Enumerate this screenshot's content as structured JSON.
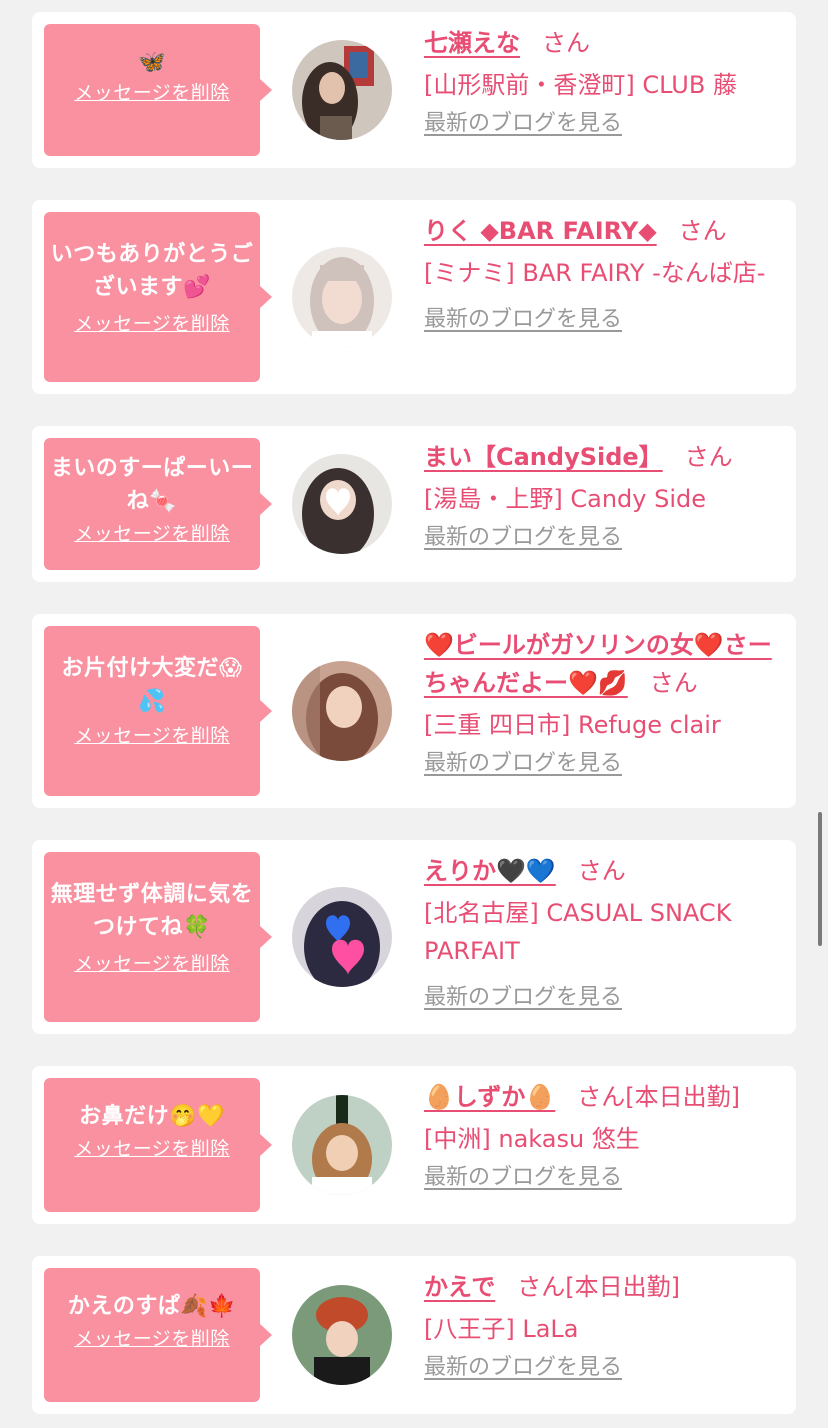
{
  "messages": [
    {
      "message": "🦋",
      "delete_label": "メッセージを削除",
      "name": "七瀬えな",
      "honorific": "さん",
      "shop": "[山形駅前・香澄町] CLUB 藤",
      "blog_label": "最新のブログを見る",
      "avatar_icon": "profile-photo",
      "avatar_color": "#6b5a4e"
    },
    {
      "message": "いつもありがとうございます💕",
      "delete_label": "メッセージを削除",
      "name": "りく ◆BAR FAIRY◆",
      "honorific": "さん",
      "shop": "[ミナミ] BAR FAIRY -なんば店-",
      "blog_label": "最新のブログを見る",
      "avatar_icon": "profile-photo",
      "avatar_color": "#e8dcd8"
    },
    {
      "message": "まいのすーぱーいーね🍬",
      "delete_label": "メッセージを削除",
      "name": "まい【CandySide】",
      "honorific": "さん",
      "shop": "[湯島・上野] Candy Side",
      "blog_label": "最新のブログを見る",
      "avatar_icon": "profile-photo",
      "avatar_color": "#3a3030"
    },
    {
      "message": "お片付け大変だ😱💦",
      "delete_label": "メッセージを削除",
      "name": "❤️ビールがガソリンの女❤️さーちゃんだよー❤️💋",
      "honorific": "さん",
      "shop": "[三重 四日市] Refuge clair",
      "blog_label": "最新のブログを見る",
      "avatar_icon": "profile-photo",
      "avatar_color": "#8a5a4a"
    },
    {
      "message": "無理せず体調に気をつけてね🍀",
      "delete_label": "メッセージを削除",
      "name": "えりか🖤💙",
      "honorific": "さん",
      "shop": "[北名古屋] CASUAL SNACK PARFAIT",
      "blog_label": "最新のブログを見る",
      "avatar_icon": "profile-photo",
      "avatar_color": "#2c2a40"
    },
    {
      "message": "お鼻だけ🤭💛",
      "delete_label": "メッセージを削除",
      "name": "🥚しずか🥚",
      "honorific": "さん[本日出勤]",
      "shop": "[中洲] nakasu 悠生",
      "blog_label": "最新のブログを見る",
      "avatar_icon": "profile-photo",
      "avatar_color": "#7a5a40"
    },
    {
      "message": "かえのすぱ🍂🍁",
      "delete_label": "メッセージを削除",
      "name": "かえで",
      "honorific": "さん[本日出勤]",
      "shop": "[八王子] LaLa",
      "blog_label": "最新のブログを見る",
      "avatar_icon": "profile-photo",
      "avatar_color": "#4a6a50"
    }
  ],
  "colors": {
    "accent_pink": "#e84e74",
    "bubble_pink": "#f991a0",
    "link_gray": "#999999",
    "page_bg": "#f1f1f1"
  }
}
